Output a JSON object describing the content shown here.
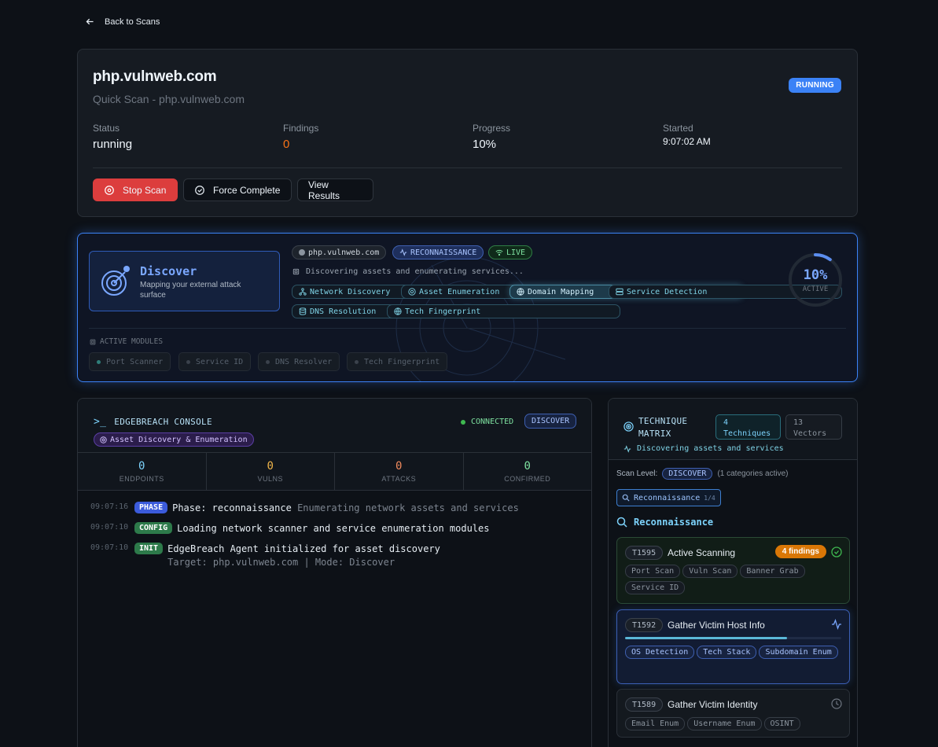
{
  "nav": {
    "back_label": "Back to Scans"
  },
  "scan": {
    "title": "php.vulnweb.com",
    "subtitle": "Quick Scan - php.vulnweb.com",
    "status_badge": "RUNNING",
    "stats": [
      {
        "label": "Status",
        "value": "running"
      },
      {
        "label": "Findings",
        "value": "0"
      },
      {
        "label": "Progress",
        "value": "10%"
      },
      {
        "label": "Started",
        "value": "9:07:02 AM"
      }
    ],
    "buttons": {
      "stop": "Stop Scan",
      "force": "Force Complete",
      "results": "View Results"
    }
  },
  "phase": {
    "name": "Discover",
    "description": "Mapping your external attack surface",
    "target_chip": "php.vulnweb.com",
    "stage_chip": "RECONNAISSANCE",
    "live_chip": "LIVE",
    "status_text": "Discovering assets and enumerating services...",
    "techniques": [
      "Network Discovery",
      "Asset Enumeration",
      "Domain Mapping",
      "Service Detection",
      "DNS Resolution",
      "Tech Fingerprint"
    ],
    "active_technique_index": 2,
    "progress_pct": "10%",
    "progress_fraction": 0.1,
    "progress_state": "ACTIVE",
    "modules_label": "ACTIVE MODULES",
    "modules": [
      "Port Scanner",
      "Service ID",
      "DNS Resolver",
      "Tech Fingerprint"
    ]
  },
  "console": {
    "title": "EDGEBREACH CONSOLE",
    "prompt": ">_",
    "tag": "Asset Discovery & Enumeration",
    "connection": "CONNECTED",
    "phase_badge": "DISCOVER",
    "metrics": [
      {
        "value": "0",
        "label": "ENDPOINTS"
      },
      {
        "value": "0",
        "label": "VULNS"
      },
      {
        "value": "0",
        "label": "ATTACKS"
      },
      {
        "value": "0",
        "label": "CONFIRMED"
      }
    ],
    "logs": [
      {
        "time": "09:07:16",
        "badge": "PHASE",
        "msg": "Phase: reconnaissance",
        "detail": "Enumerating network assets and services"
      },
      {
        "time": "09:07:10",
        "badge": "CONFIG",
        "msg": "Loading network scanner and service enumeration modules",
        "detail": ""
      },
      {
        "time": "09:07:10",
        "badge": "INIT",
        "msg": "EdgeBreach Agent initialized for asset discovery",
        "detail": "Target: php.vulnweb.com | Mode: Discover"
      }
    ]
  },
  "matrix": {
    "title": "TECHNIQUE MATRIX",
    "techniques_count": "4",
    "techniques_label": "Techniques",
    "vectors_count": "13",
    "vectors_label": "Vectors",
    "subtitle": "Discovering assets and services",
    "scan_level_label": "Scan Level:",
    "scan_level": "DISCOVER",
    "scan_level_note": "(1 categories active)",
    "filter_label": "Reconnaissance",
    "filter_fraction": "1/4",
    "section_title": "Reconnaissance",
    "items": [
      {
        "id": "T1595",
        "name": "Active Scanning",
        "findings": "4 findings",
        "tags": [
          "Port Scan",
          "Vuln Scan",
          "Banner Grab",
          "Service ID"
        ]
      },
      {
        "id": "T1592",
        "name": "Gather Victim Host Info",
        "progress": 0.75,
        "tags": [
          "OS Detection",
          "Tech Stack",
          "Subdomain Enum"
        ]
      },
      {
        "id": "T1589",
        "name": "Gather Victim Identity",
        "tags": [
          "Email Enum",
          "Username Enum",
          "OSINT"
        ]
      }
    ]
  }
}
